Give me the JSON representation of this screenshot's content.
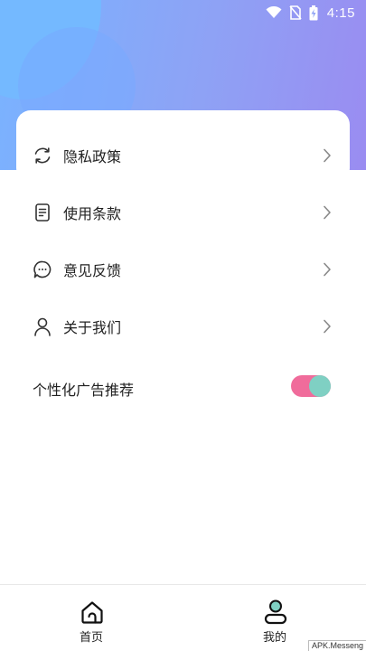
{
  "status_bar": {
    "time": "4:15",
    "icons": [
      "wifi-icon",
      "no-sim-icon",
      "battery-charging-icon"
    ]
  },
  "menu": {
    "items": [
      {
        "label": "隐私政策",
        "icon": "refresh-icon"
      },
      {
        "label": "使用条款",
        "icon": "document-icon"
      },
      {
        "label": "意见反馈",
        "icon": "chat-bubble-icon"
      },
      {
        "label": "关于我们",
        "icon": "person-icon"
      }
    ]
  },
  "ad_setting": {
    "label": "个性化广告推荐",
    "enabled": true,
    "track_color": "#f06c9b",
    "knob_color": "#7fd0c3"
  },
  "bottom_nav": {
    "tabs": [
      {
        "label": "首页",
        "icon": "home-icon"
      },
      {
        "label": "我的",
        "icon": "profile-icon"
      }
    ]
  },
  "watermark": "APK.Messeng",
  "colors": {
    "header_gradient_start": "#79b3ff",
    "header_gradient_end": "#9a8cf1"
  }
}
